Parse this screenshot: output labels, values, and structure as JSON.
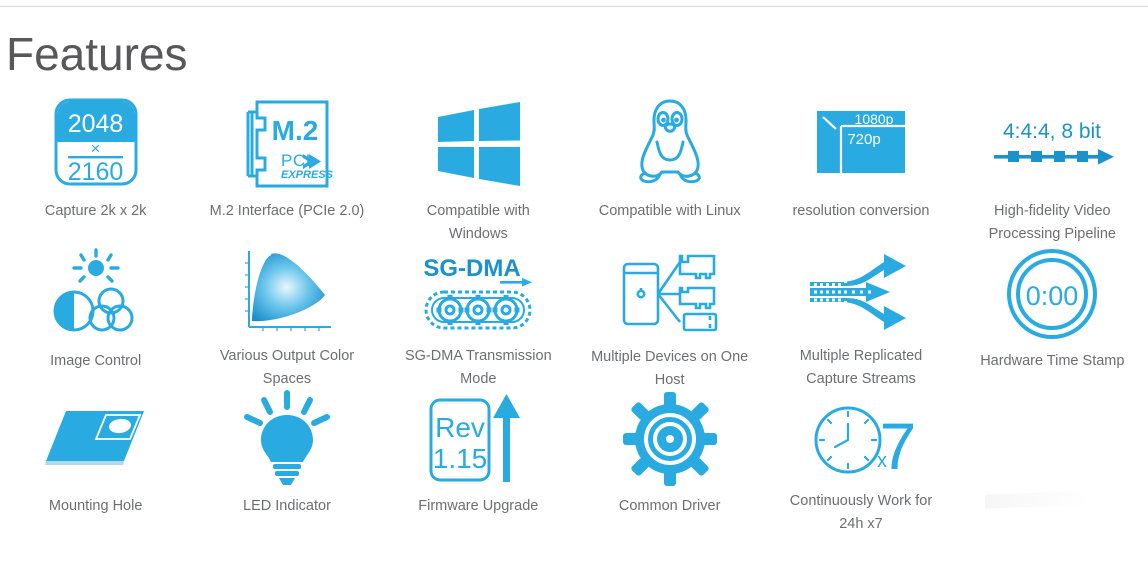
{
  "header": {
    "title": "Features"
  },
  "colors": {
    "accent": "#29abe2",
    "accent_dark": "#1c92cc",
    "label_text": "#6d6e71",
    "title_text": "#58585b",
    "rule": "#d9d9d9",
    "background": "#ffffff"
  },
  "features": [
    {
      "icon": "resolution-2048x2160-icon",
      "label": "Capture 2k x 2k",
      "icon_text": {
        "top": "2048",
        "mid": "×",
        "bottom": "2160"
      }
    },
    {
      "icon": "m2-pcie-card-icon",
      "label": "M.2 Interface (PCIe 2.0)",
      "icon_text": {
        "title": "M.2",
        "logo_top": "PCI",
        "logo_bottom": "EXPRESS"
      }
    },
    {
      "icon": "windows-logo-icon",
      "label": "Compatible with Windows"
    },
    {
      "icon": "linux-tux-penguin-icon",
      "label": "Compatible with Linux"
    },
    {
      "icon": "resolution-conversion-icon",
      "label": "resolution conversion",
      "icon_text": {
        "outer": "1080p",
        "inner": "720p"
      }
    },
    {
      "icon": "video-pipeline-arrow-icon",
      "label": "High-fidelity Video Processing Pipeline",
      "icon_text": {
        "format": "4:4:4, 8 bit"
      }
    },
    {
      "icon": "image-control-icon",
      "label": "Image Control"
    },
    {
      "icon": "color-space-chromaticity-icon",
      "label": "Various Output Color Spaces"
    },
    {
      "icon": "sg-dma-gears-icon",
      "label": "SG-DMA Transmission Mode",
      "icon_text": {
        "title": "SG-DMA"
      }
    },
    {
      "icon": "multiple-devices-host-icon",
      "label": "Multiple Devices on One Host"
    },
    {
      "icon": "replicated-streams-arrows-icon",
      "label": "Multiple Replicated Capture Streams"
    },
    {
      "icon": "hardware-timestamp-clock-icon",
      "label": "Hardware Time Stamp",
      "icon_text": {
        "time": "0:00"
      }
    },
    {
      "icon": "mounting-hole-plate-icon",
      "label": "Mounting Hole"
    },
    {
      "icon": "led-lightbulb-icon",
      "label": "LED Indicator"
    },
    {
      "icon": "firmware-upgrade-icon",
      "label": "Firmware Upgrade",
      "icon_text": {
        "rev": "Rev",
        "version": "1.15"
      }
    },
    {
      "icon": "gear-driver-icon",
      "label": "Common Driver"
    },
    {
      "icon": "clock-24x7-icon",
      "label": "Continuously Work for 24h x7",
      "icon_text": {
        "multiplier": "x",
        "days": "7"
      }
    },
    {
      "icon": "empty-slot",
      "label": ""
    }
  ]
}
